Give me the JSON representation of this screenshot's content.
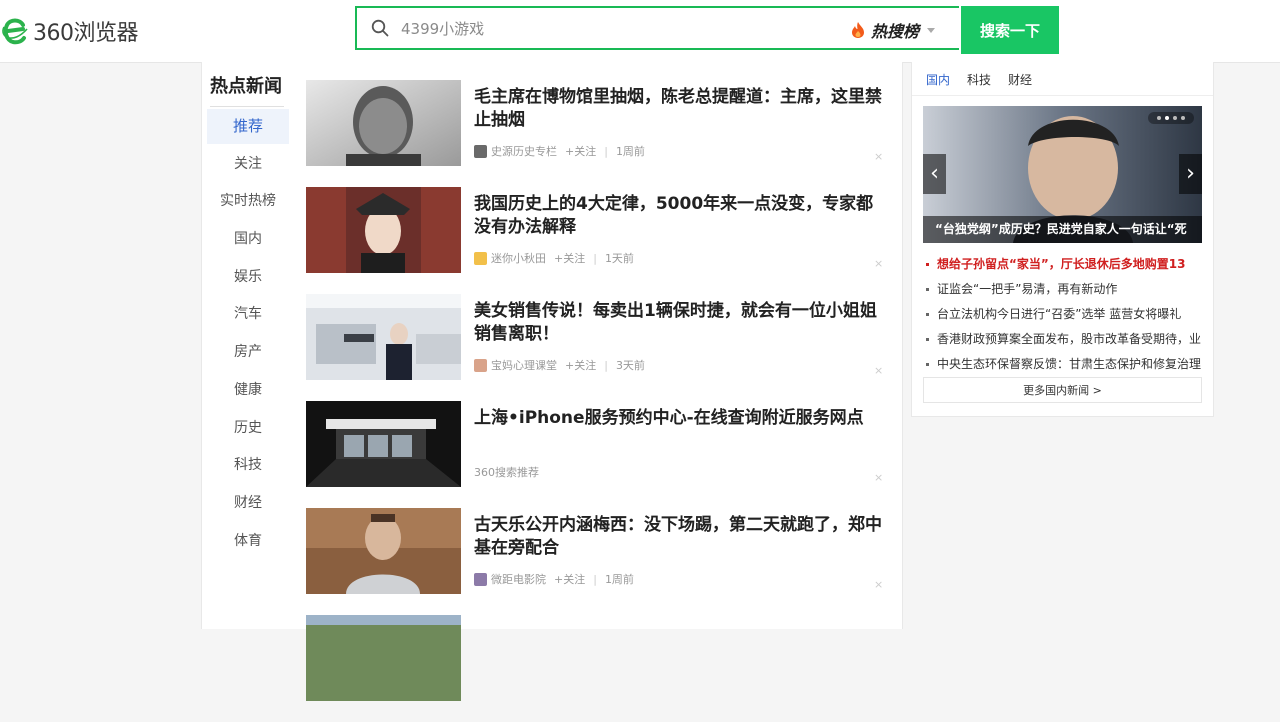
{
  "header": {
    "logo_text": "360浏览器",
    "search_placeholder": "4399小游戏",
    "hot_rank_label": "热搜榜",
    "search_button": "搜索一下"
  },
  "sidebar": {
    "title": "热点新闻",
    "items": [
      {
        "label": "推荐",
        "active": true
      },
      {
        "label": "关注"
      },
      {
        "label": "实时热榜"
      },
      {
        "label": "国内"
      },
      {
        "label": "娱乐"
      },
      {
        "label": "汽车"
      },
      {
        "label": "房产"
      },
      {
        "label": "健康"
      },
      {
        "label": "历史"
      },
      {
        "label": "科技"
      },
      {
        "label": "财经"
      },
      {
        "label": "体育"
      }
    ]
  },
  "feed": [
    {
      "title": "毛主席在博物馆里抽烟，陈老总提醒道：主席，这里禁止抽烟",
      "source": "史源历史专栏",
      "follow": "+关注",
      "time": "1周前",
      "dismiss": "×"
    },
    {
      "title": "我国历史上的4大定律，5000年来一点没变，专家都没有办法解释",
      "source": "迷你小秋田",
      "follow": "+关注",
      "time": "1天前",
      "dismiss": "×"
    },
    {
      "title": "美女销售传说！每卖出1辆保时捷，就会有一位小姐姐销售离职！",
      "source": "宝妈心理课堂",
      "follow": "+关注",
      "time": "3天前",
      "dismiss": "×"
    },
    {
      "title": "上海•iPhone服务预约中心-在线查询附近服务网点",
      "source": "360搜索推荐",
      "follow": "",
      "time": "",
      "dismiss": "×"
    },
    {
      "title": "古天乐公开内涵梅西：没下场踢，第二天就跑了，郑中基在旁配合",
      "source": "微距电影院",
      "follow": "+关注",
      "time": "1周前",
      "dismiss": "×"
    }
  ],
  "right_panel": {
    "tabs": [
      {
        "label": "国内",
        "active": true
      },
      {
        "label": "科技"
      },
      {
        "label": "财经"
      }
    ],
    "carousel": {
      "caption": "“台独党纲”成历史？民进党自家人一句话让“死",
      "prev": "‹",
      "next": "›"
    },
    "headlines": [
      {
        "text": "想给子孙留点“家当”，厅长退休后多地购置13",
        "hot": true
      },
      {
        "text": "证监会“一把手”易清，再有新动作"
      },
      {
        "text": "台立法机构今日进行“召委”选举 蓝营女将曝礼"
      },
      {
        "text": "香港财政预算案全面发布，股市改革备受期待，业"
      },
      {
        "text": "中央生态环保督察反馈：甘肃生态保护和修复治理"
      }
    ],
    "more_label": "更多国内新闻 >"
  }
}
